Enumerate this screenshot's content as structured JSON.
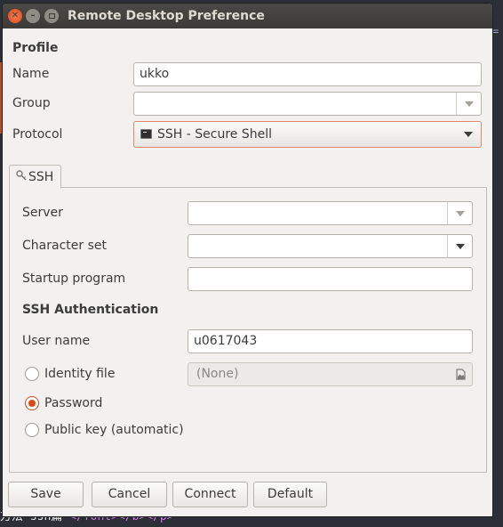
{
  "window": {
    "title": "Remote Desktop Preference"
  },
  "profile": {
    "heading": "Profile",
    "name_label": "Name",
    "name_value": "ukko",
    "group_label": "Group",
    "group_value": "",
    "protocol_label": "Protocol",
    "protocol_value": "SSH - Secure Shell",
    "protocol_icon": "terminal-icon"
  },
  "tabs": [
    {
      "label": "SSH",
      "icon": "key-icon"
    }
  ],
  "ssh": {
    "server_label": "Server",
    "server_value": "",
    "charset_label": "Character set",
    "charset_value": "",
    "startup_label": "Startup program",
    "startup_value": "",
    "auth_heading": "SSH Authentication",
    "username_label": "User name",
    "username_value": "u0617043",
    "auth_options": [
      {
        "label": "Identity file",
        "selected": false
      },
      {
        "label": "Password",
        "selected": true
      },
      {
        "label": "Public key (automatic)",
        "selected": false
      }
    ],
    "identity_file_value": "(None)"
  },
  "buttons": {
    "save": "Save",
    "cancel": "Cancel",
    "connect": "Connect",
    "default": "Default"
  },
  "background": {
    "code_text": "方法-ssh篇",
    "code_tag": "</font></b></p>",
    "edge_glyph": "="
  },
  "colors": {
    "accent": "#dd4814",
    "titlebar": "#3c3b37",
    "window_bg": "#f2f1f0"
  }
}
